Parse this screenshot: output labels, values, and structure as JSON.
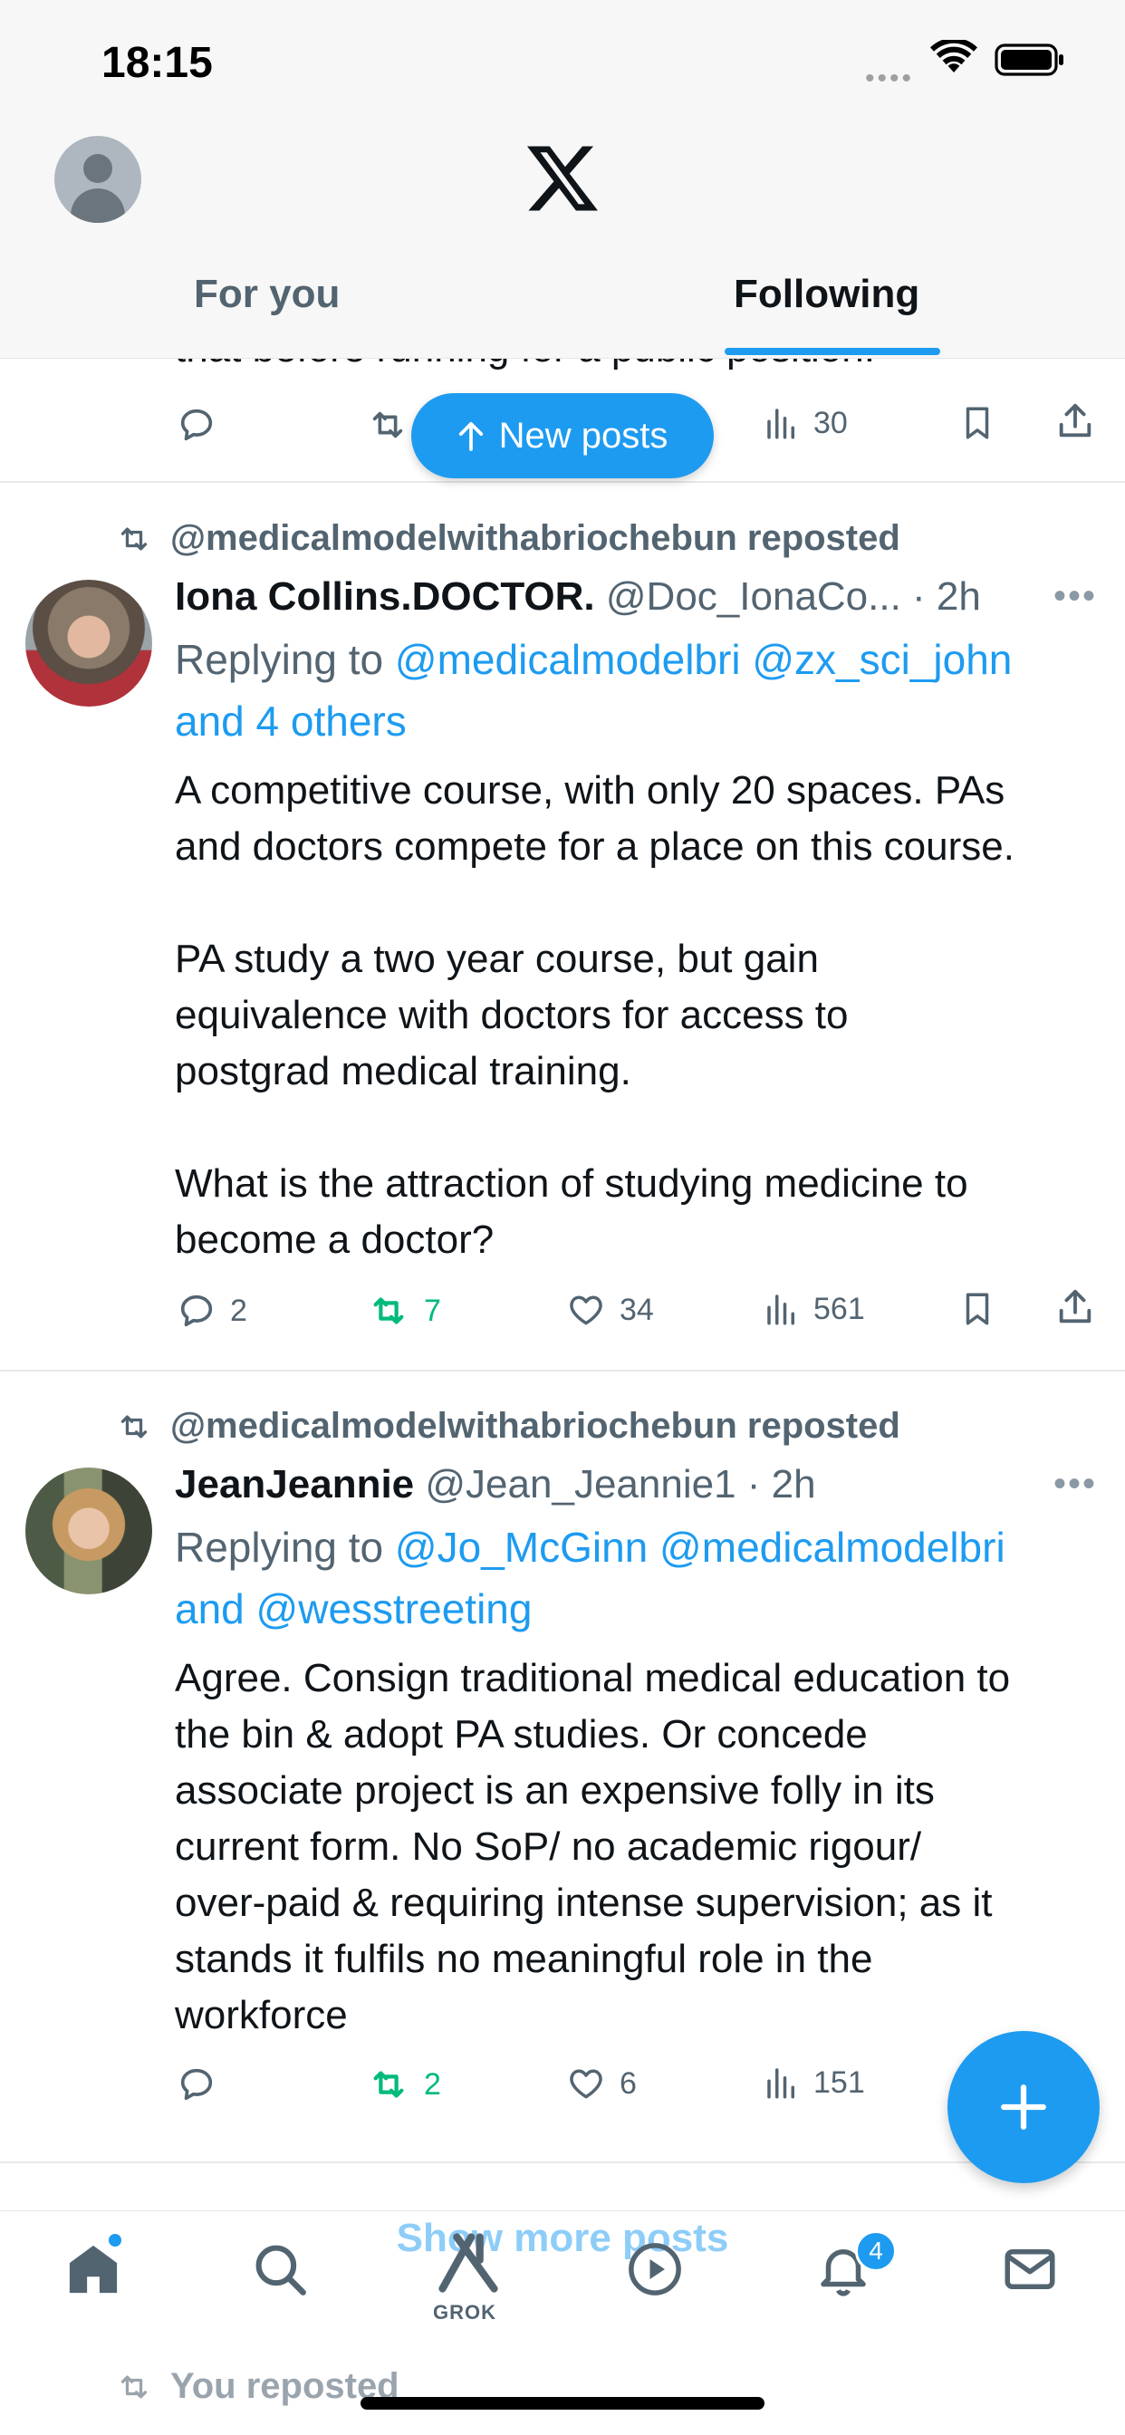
{
  "status_bar": {
    "time": "18:15"
  },
  "header": {
    "tabs": [
      {
        "label": "For you"
      },
      {
        "label": "Following"
      }
    ]
  },
  "prev_post": {
    "partial_text": "that before running for a public position.",
    "views": "30"
  },
  "new_posts_label": "New posts",
  "posts": [
    {
      "repost_by": "@medicalmodelwithabriochebun reposted",
      "name": "Iona Collins.DOCTOR.",
      "handle_time": "@Doc_IonaCo... · 2h",
      "reply_prefix": "Replying to ",
      "mentions_line1": "@medicalmodelbri @zx_sci_john",
      "mentions_line2": "and 4 others",
      "text_p1_l1": "A competitive course, with only 20 spaces. PAs",
      "text_p1_l2": "and doctors compete for a place on this course.",
      "text_p2_l1": "PA study a two year course, but gain",
      "text_p2_l2": "equivalence with doctors for access to",
      "text_p2_l3": "postgrad medical training.",
      "text_p3_l1": "What is the attraction of studying medicine to",
      "text_p3_l2": "become a doctor?",
      "replies": "2",
      "reposts": "7",
      "likes": "34",
      "views": "561"
    },
    {
      "repost_by": "@medicalmodelwithabriochebun reposted",
      "name": "JeanJeannie",
      "handle_time": "@Jean_Jeannie1 · 2h",
      "reply_prefix": "Replying to ",
      "mentions_line1": "@Jo_McGinn @medicalmodelbri",
      "mentions_line2_prefix": "and ",
      "mentions_line2": "@wesstreeting",
      "text_l1": "Agree. Consign traditional medical education to",
      "text_l2": "the bin & adopt PA studies. Or concede",
      "text_l3": "associate project is an expensive folly in its",
      "text_l4": "current form. No SoP/ no academic rigour/",
      "text_l5": "over-paid & requiring intense supervision; as it",
      "text_l6": "stands it fulfils no meaningful role in the",
      "text_l7": "workforce",
      "reposts": "2",
      "likes": "6",
      "views": "151"
    }
  ],
  "show_more_label": "Show more posts",
  "tabbar": {
    "grok_label": "GROK",
    "notification_count": "4"
  },
  "below": {
    "you_reposted": "You reposted"
  },
  "colors": {
    "accent": "#1d9bf0",
    "repost_green": "#00ba7c",
    "muted": "#536471"
  },
  "icons": [
    "home-icon",
    "search-icon",
    "grok-icon",
    "play-icon",
    "bell-icon",
    "mail-icon",
    "plus-icon",
    "x-logo-icon"
  ]
}
